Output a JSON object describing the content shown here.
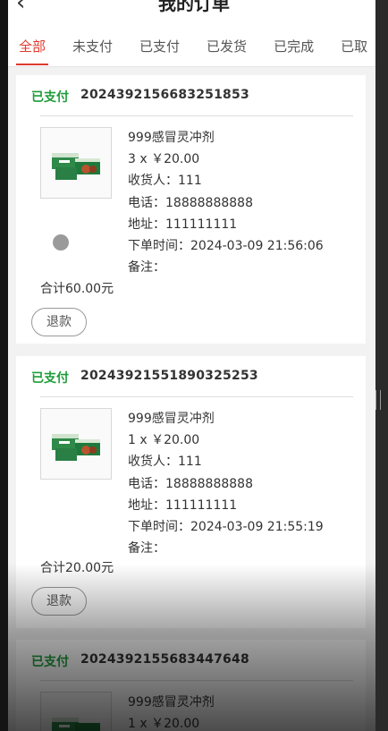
{
  "header": {
    "title": "我的订单",
    "back_icon": "chevron-left-icon"
  },
  "tabs": [
    {
      "label": "全部",
      "active": true
    },
    {
      "label": "未支付",
      "active": false
    },
    {
      "label": "已支付",
      "active": false
    },
    {
      "label": "已发货",
      "active": false
    },
    {
      "label": "已完成",
      "active": false
    },
    {
      "label": "已取",
      "active": false
    }
  ],
  "labels": {
    "receiver": "收货人：",
    "phone": "电话：",
    "address": "地址：",
    "order_time": "下单时间：",
    "note": "备注：",
    "total_prefix": "合计",
    "total_suffix": "元"
  },
  "orders": [
    {
      "status": "已支付",
      "order_no": "2024392156683251853",
      "product": "999感冒灵冲剂",
      "qty_price": "3 x ￥20.00",
      "receiver": "111",
      "phone": "18888888888",
      "address": "111111111",
      "order_time": "2024-03-09 21:56:06",
      "note": "",
      "total": "60.00",
      "refund_label": "退款"
    },
    {
      "status": "已支付",
      "order_no": "20243921551890325253",
      "product": "999感冒灵冲剂",
      "qty_price": "1 x ￥20.00",
      "receiver": "111",
      "phone": "18888888888",
      "address": "111111111",
      "order_time": "2024-03-09 21:55:19",
      "note": "",
      "total": "20.00",
      "refund_label": "退款"
    },
    {
      "status": "已支付",
      "order_no": "2024392155683447648",
      "product": "999感冒灵冲剂",
      "qty_price": "1 x ￥20.00"
    }
  ],
  "colors": {
    "accent": "#e03a2f",
    "paid_status": "#1f9d3a"
  }
}
